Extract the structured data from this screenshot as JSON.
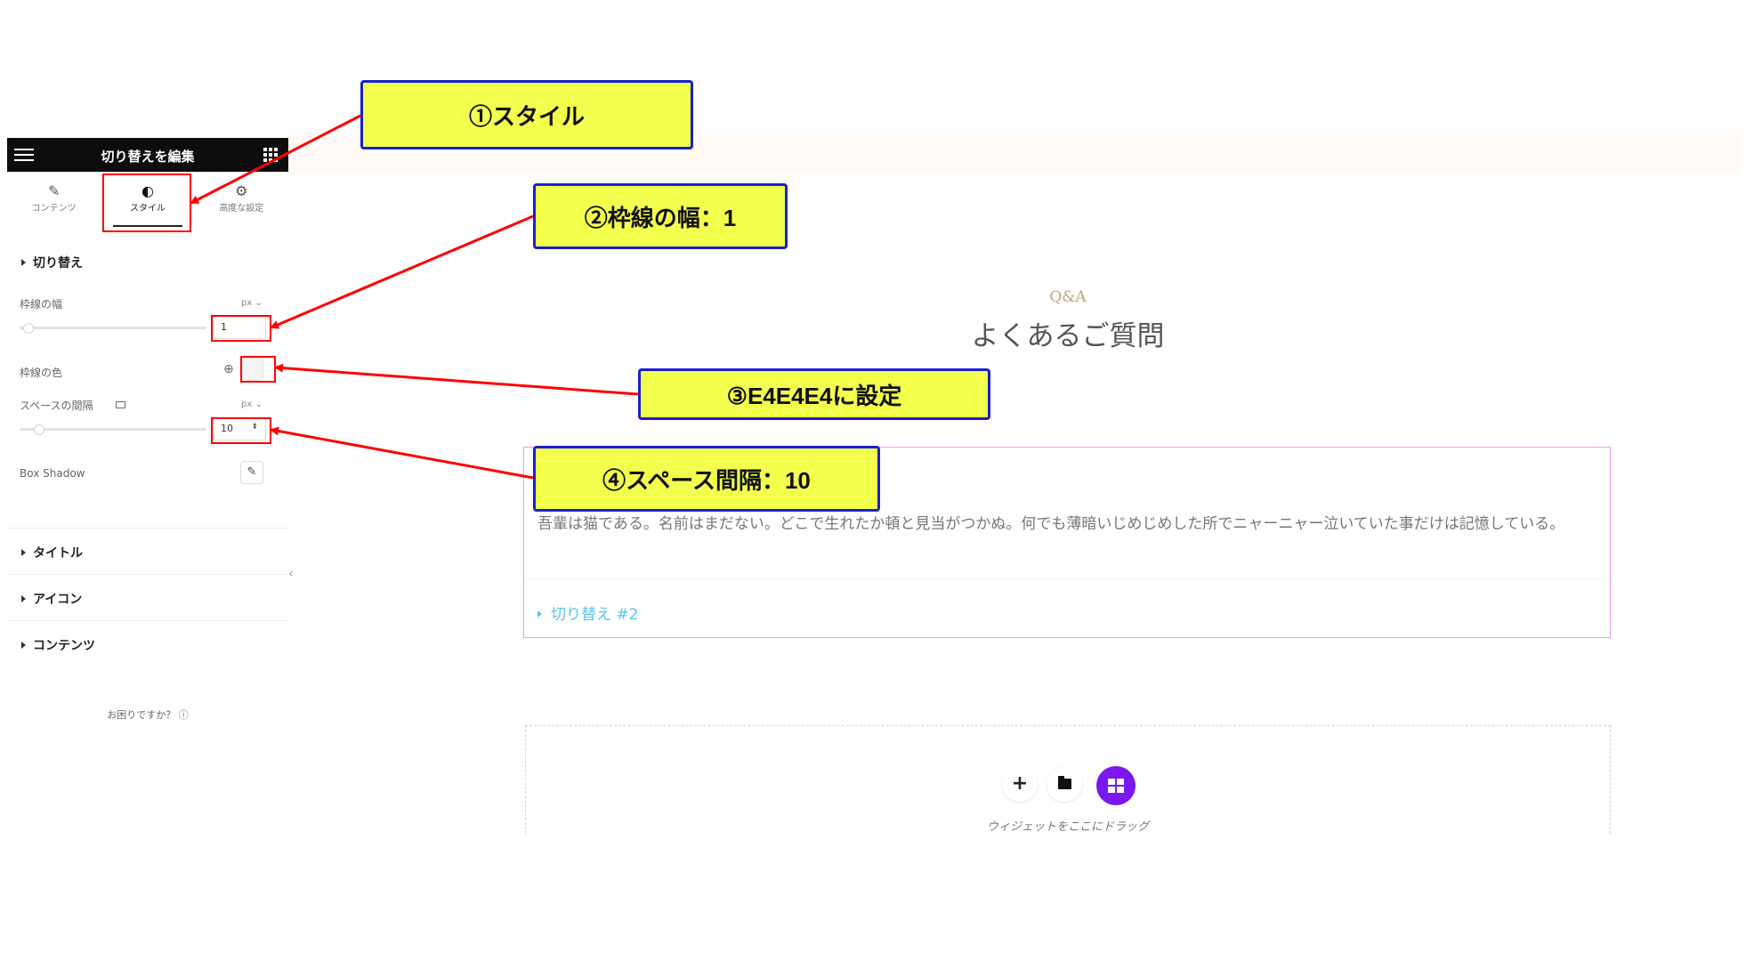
{
  "panel": {
    "title": "切り替えを編集",
    "tabs": [
      {
        "label": "コンテンツ",
        "icon": "pencil-icon"
      },
      {
        "label": "スタイル",
        "icon": "contrast-icon"
      },
      {
        "label": "高度な設定",
        "icon": "gear-icon"
      }
    ],
    "section_toggle": "切り替え",
    "border_width_label": "枠線の幅",
    "border_width_unit": "px",
    "border_width_value": "1",
    "border_color_label": "枠線の色",
    "spacing_label": "スペースの間隔",
    "spacing_unit": "px",
    "spacing_value": "10",
    "box_shadow_label": "Box Shadow",
    "section_title": "タイトル",
    "section_icon": "アイコン",
    "section_content": "コンテンツ",
    "help": "お困りですか？"
  },
  "canvas": {
    "qa_small": "Q&A",
    "qa_title": "よくあるご質問",
    "accordion_body": "吾輩は猫である。名前はまだない。どこで生れたか頓と見当がつかぬ。何でも薄暗いじめじめした所でニャーニャー泣いていた事だけは記憶している。",
    "accordion_item2": "切り替え #2",
    "drop_label": "ウィジェットをここにドラッグ"
  },
  "annotations": {
    "c1": "①スタイル",
    "c2": "②枠線の幅：1",
    "c3": "③E4E4E4に設定",
    "c4": "④スペース間隔：10"
  },
  "colors": {
    "callout_fill": "#f2ff4d",
    "callout_border": "#1a1fd1",
    "highlight": "#ff0000",
    "accordion_border": "#ec9ff1",
    "accordion_item_link": "#5ac4e8",
    "add_template_button": "#7a18ee",
    "border_color_value": "#E4E4E4"
  }
}
